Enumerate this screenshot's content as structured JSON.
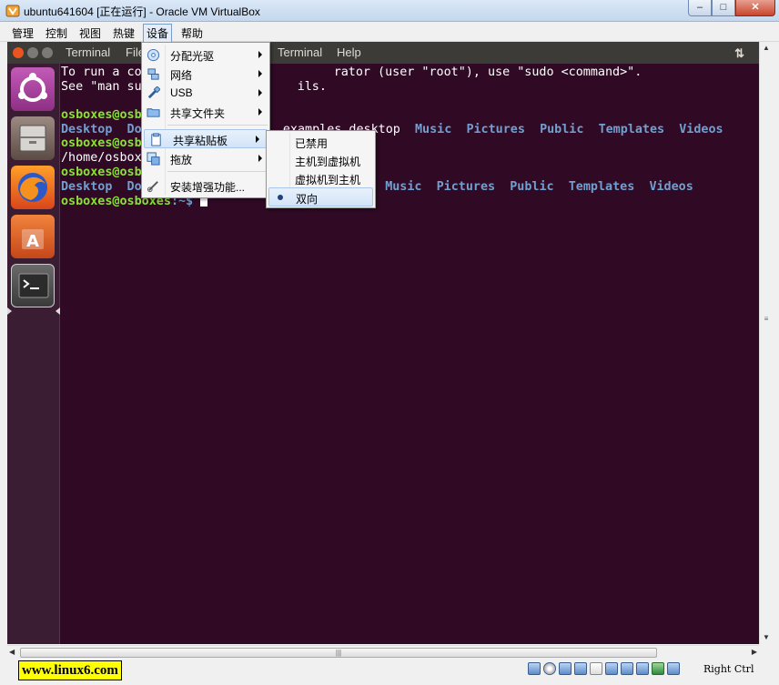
{
  "window": {
    "title": "ubuntu641604 [正在运行] - Oracle VM VirtualBox",
    "buttons": [
      "–",
      "□",
      "✕"
    ]
  },
  "menubar": {
    "items": [
      "管理",
      "控制",
      "视图",
      "热键",
      "设备",
      "帮助"
    ],
    "active": "设备"
  },
  "guest_topbar": {
    "left_items": [
      "Terminal",
      "File"
    ],
    "right_items": [
      "Terminal",
      "Help"
    ],
    "sort_icon": "⇅"
  },
  "terminal": {
    "line1_a": "To run a co",
    "line1_b": "rator (user \"root\"), use \"sudo <command>\".",
    "line2_a": "See \"man su",
    "line2_b": "ils.",
    "prompt": "osboxes@osb",
    "prompt2": "osboxes@osb",
    "prompt_full": "osboxes@osboxes",
    "prompt_suffix": ":~$ ",
    "ls1_a": "Desktop  Do",
    "ls1_b": "s  examples.desktop",
    "ls2_b": "esktop",
    "dirs_tail": [
      "Music",
      "Pictures",
      "Public",
      "Templates",
      "Videos"
    ],
    "home_line": "/home/osbox",
    "prompt3": "osboxes@osb",
    "ls2_a": "Desktop  Do"
  },
  "devices_menu": {
    "items": [
      {
        "label": "分配光驱",
        "icon": "optical-disc-icon",
        "submenu": true
      },
      {
        "label": "网络",
        "icon": "network-icon",
        "submenu": true
      },
      {
        "label": "USB",
        "icon": "usb-icon",
        "submenu": true
      },
      {
        "label": "共享文件夹",
        "icon": "shared-folder-icon",
        "submenu": true
      },
      {
        "label": "共享粘贴板",
        "icon": "clipboard-icon",
        "submenu": true
      },
      {
        "label": "拖放",
        "icon": "drag-drop-icon",
        "submenu": true
      },
      {
        "label": "安装增强功能...",
        "icon": "guest-additions-icon",
        "submenu": false
      }
    ],
    "highlighted": "共享粘贴板"
  },
  "clipboard_menu": {
    "items": [
      "已禁用",
      "主机到虚拟机",
      "虚拟机到主机",
      "双向"
    ],
    "selected": "双向"
  },
  "statusbar": {
    "watermark": "www.linux6.com",
    "host_key": "Right Ctrl",
    "icons": [
      "hard-disk-icon",
      "optical-disc-icon",
      "network-icon",
      "usb-icon",
      "shared-folder-icon",
      "display-icon",
      "video-capture-icon",
      "cpu-icon",
      "mouse-icon",
      "keyboard-arrow-icon"
    ]
  },
  "scroll": {
    "thumb_grip": "≡",
    "h_grip": "|||"
  },
  "colors": {
    "terminal_bg": "#300a24",
    "prompt_green": "#8ae234",
    "dir_blue": "#729fcf",
    "menu_highlight": "#d2e4f8"
  }
}
